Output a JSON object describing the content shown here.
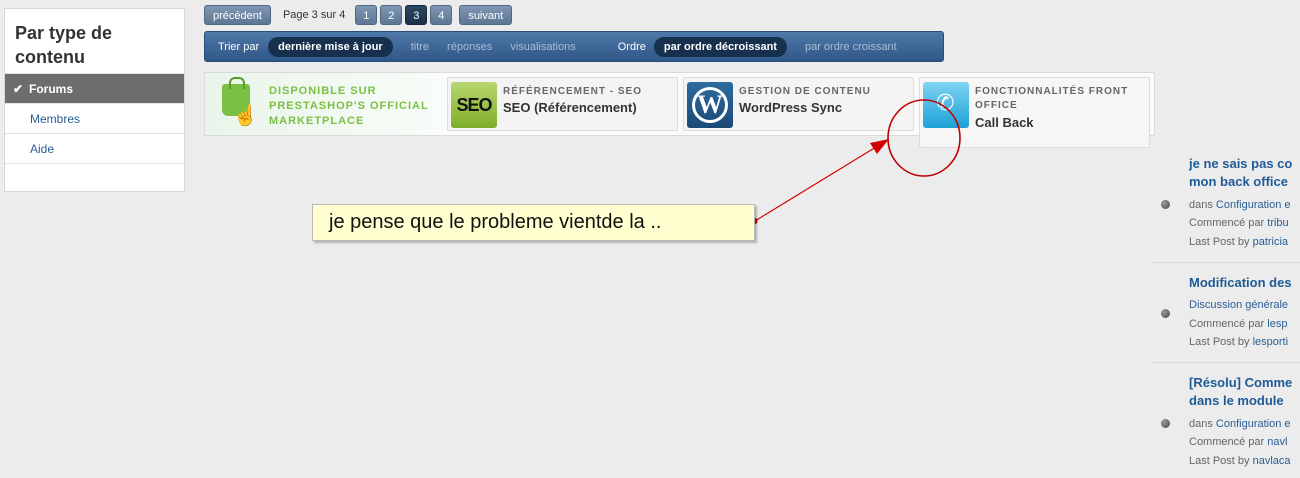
{
  "sidebar": {
    "title": "Par type de contenu",
    "items": [
      {
        "label": "Forums",
        "active": true
      },
      {
        "label": "Membres",
        "active": false
      },
      {
        "label": "Aide",
        "active": false
      }
    ]
  },
  "pagination": {
    "prev": "précédent",
    "page_info": "Page 3 sur 4",
    "pages": [
      "1",
      "2",
      "3",
      "4"
    ],
    "current": "3",
    "next": "suivant"
  },
  "sortbar": {
    "sort_label": "Trier par",
    "sort_active": "dernière mise à jour",
    "sort_options": [
      "titre",
      "réponses",
      "visualisations"
    ],
    "order_label": "Ordre",
    "order_active": "par ordre décroissant",
    "order_other": "par ordre croissant"
  },
  "ads": {
    "main": "DISPONIBLE SUR PRESTASHOP'S OFFICIAL MARKETPLACE",
    "cards": [
      {
        "category": "RÉFÉRENCEMENT - SEO",
        "name": "SEO (Référencement)",
        "logo_text": "SEO"
      },
      {
        "category": "GESTION DE CONTENU",
        "name": "WordPress Sync",
        "logo_text": "W"
      },
      {
        "category": "FONCTIONNALITÉS FRONT OFFICE",
        "name": "Call Back",
        "logo_text": ""
      }
    ]
  },
  "annotation": {
    "text": "je pense que le probleme vientde la ..",
    "color": "#d40000"
  },
  "topics": [
    {
      "title_lines": [
        "je ne sais pas co",
        "mon back office"
      ],
      "meta": [
        {
          "prefix": "dans ",
          "link": "Configuration e"
        },
        {
          "prefix": "Commencé par ",
          "link": "tribu"
        },
        {
          "prefix": "Last Post by ",
          "link": "patricia"
        }
      ]
    },
    {
      "title_lines": [
        "Modification des"
      ],
      "meta": [
        {
          "prefix": "",
          "link": "Discussion générale"
        },
        {
          "prefix": "Commencé par ",
          "link": "lesp"
        },
        {
          "prefix": "Last Post by ",
          "link": "lesporti"
        }
      ]
    },
    {
      "title_lines": [
        "[Résolu] Comme",
        "dans le module"
      ],
      "meta": [
        {
          "prefix": "dans ",
          "link": "Configuration e"
        },
        {
          "prefix": "Commencé par ",
          "link": "navl"
        },
        {
          "prefix": "Last Post by ",
          "link": "navlaca"
        }
      ]
    }
  ]
}
